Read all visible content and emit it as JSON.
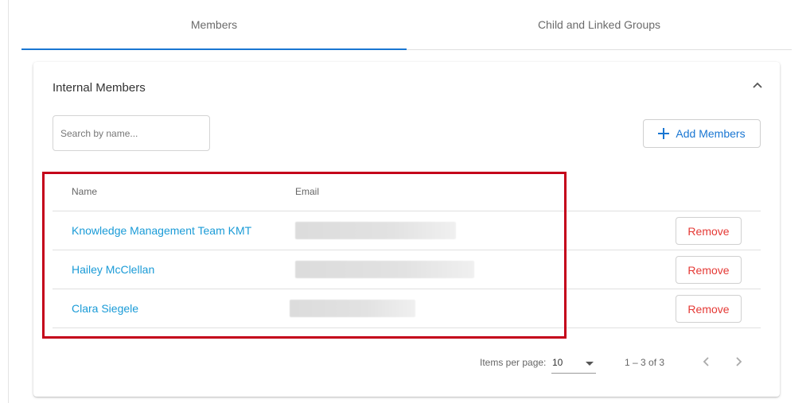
{
  "tabs": [
    {
      "label": "Members",
      "active": true
    },
    {
      "label": "Child and Linked Groups",
      "active": false
    }
  ],
  "card": {
    "title": "Internal Members",
    "search_placeholder": "Search by name...",
    "add_button_label": "Add Members"
  },
  "table": {
    "headers": {
      "name": "Name",
      "email": "Email"
    },
    "rows": [
      {
        "name": "Knowledge Management Team KMT",
        "remove_label": "Remove"
      },
      {
        "name": "Hailey McClellan",
        "remove_label": "Remove"
      },
      {
        "name": "Clara Siegele",
        "remove_label": "Remove"
      }
    ]
  },
  "paginator": {
    "items_per_page_label": "Items per page:",
    "items_per_page_value": "10",
    "range_label": "1 – 3 of 3"
  },
  "colors": {
    "accent": "#1976d2",
    "link": "#1a9bd7",
    "danger": "#e53935",
    "highlight": "#c4001a"
  },
  "icons": {
    "collapse": "chevron-up-icon",
    "add": "plus-icon",
    "prev": "chevron-left-icon",
    "next": "chevron-right-icon",
    "select": "caret-down-icon"
  }
}
